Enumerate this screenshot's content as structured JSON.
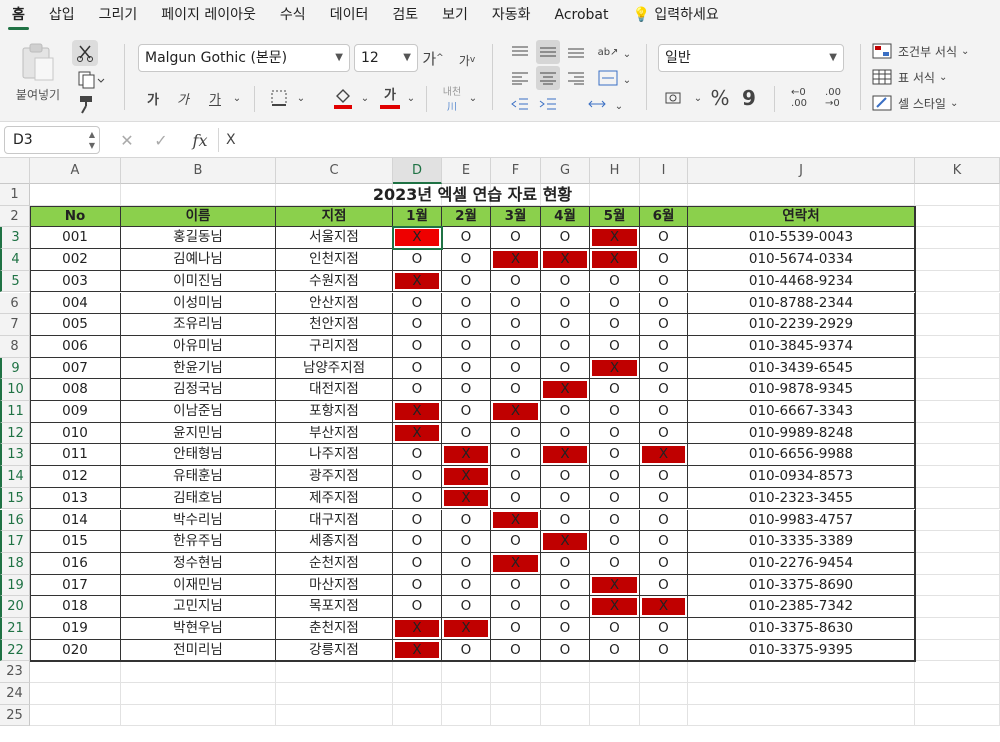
{
  "ribbon_tabs": [
    "홈",
    "삽입",
    "그리기",
    "페이지 레이아웃",
    "수식",
    "데이터",
    "검토",
    "보기",
    "자동화",
    "Acrobat",
    "입력하세요"
  ],
  "ribbon": {
    "paste_label": "붙여넣기",
    "font_name": "Malgun Gothic (본문)",
    "font_size": "12",
    "grow_font": "가",
    "shrink_font": "가",
    "bold": "가",
    "italic": "가",
    "underline": "가",
    "font_color_glyph": "가",
    "phonetic_label": "내천",
    "number_format": "일반",
    "conditional_format": "조건부 서식",
    "format_as_table": "표 서식",
    "cell_styles": "셀 스타일",
    "percent": "%",
    "comma": "9",
    "inc_decimal": "←0\n.00",
    "dec_decimal": ".00\n→0"
  },
  "formula_bar": {
    "name_box": "D3",
    "fx": "fx",
    "content": "X"
  },
  "columns": [
    "A",
    "B",
    "C",
    "D",
    "E",
    "F",
    "G",
    "H",
    "I",
    "J",
    "K"
  ],
  "rows": [
    "1",
    "2",
    "3",
    "4",
    "5",
    "6",
    "7",
    "8",
    "9",
    "10",
    "11",
    "12",
    "13",
    "14",
    "15",
    "16",
    "17",
    "18",
    "19",
    "20",
    "21",
    "22",
    "23",
    "24",
    "25"
  ],
  "sheet": {
    "title": "2023년 엑셀 연습 자료 현황",
    "headers": [
      "No",
      "이름",
      "지점",
      "1월",
      "2월",
      "3월",
      "4월",
      "5월",
      "6월",
      "연락처"
    ],
    "records": [
      [
        "001",
        "홍길동님",
        "서울지점",
        "X",
        "O",
        "O",
        "O",
        "X",
        "O",
        "010-5539-0043"
      ],
      [
        "002",
        "김예나님",
        "인천지점",
        "O",
        "O",
        "X",
        "X",
        "X",
        "O",
        "010-5674-0334"
      ],
      [
        "003",
        "이미진님",
        "수원지점",
        "X",
        "O",
        "O",
        "O",
        "O",
        "O",
        "010-4468-9234"
      ],
      [
        "004",
        "이성미님",
        "안산지점",
        "O",
        "O",
        "O",
        "O",
        "O",
        "O",
        "010-8788-2344"
      ],
      [
        "005",
        "조유리님",
        "천안지점",
        "O",
        "O",
        "O",
        "O",
        "O",
        "O",
        "010-2239-2929"
      ],
      [
        "006",
        "아유미님",
        "구리지점",
        "O",
        "O",
        "O",
        "O",
        "O",
        "O",
        "010-3845-9374"
      ],
      [
        "007",
        "한윤기님",
        "남양주지점",
        "O",
        "O",
        "O",
        "O",
        "X",
        "O",
        "010-3439-6545"
      ],
      [
        "008",
        "김정국님",
        "대전지점",
        "O",
        "O",
        "O",
        "X",
        "O",
        "O",
        "010-9878-9345"
      ],
      [
        "009",
        "이남준님",
        "포항지점",
        "X",
        "O",
        "X",
        "O",
        "O",
        "O",
        "010-6667-3343"
      ],
      [
        "010",
        "윤지민님",
        "부산지점",
        "X",
        "O",
        "O",
        "O",
        "O",
        "O",
        "010-9989-8248"
      ],
      [
        "011",
        "안태형님",
        "나주지점",
        "O",
        "X",
        "O",
        "X",
        "O",
        "X",
        "010-6656-9988"
      ],
      [
        "012",
        "유태훈님",
        "광주지점",
        "O",
        "X",
        "O",
        "O",
        "O",
        "O",
        "010-0934-8573"
      ],
      [
        "013",
        "김태호님",
        "제주지점",
        "O",
        "X",
        "O",
        "O",
        "O",
        "O",
        "010-2323-3455"
      ],
      [
        "014",
        "박수리님",
        "대구지점",
        "O",
        "O",
        "X",
        "O",
        "O",
        "O",
        "010-9983-4757"
      ],
      [
        "015",
        "한유주님",
        "세종지점",
        "O",
        "O",
        "O",
        "X",
        "O",
        "O",
        "010-3335-3389"
      ],
      [
        "016",
        "정수현님",
        "순천지점",
        "O",
        "O",
        "X",
        "O",
        "O",
        "O",
        "010-2276-9454"
      ],
      [
        "017",
        "이재민님",
        "마산지점",
        "O",
        "O",
        "O",
        "O",
        "X",
        "O",
        "010-3375-8690"
      ],
      [
        "018",
        "고민지님",
        "목포지점",
        "O",
        "O",
        "O",
        "O",
        "X",
        "X",
        "010-2385-7342"
      ],
      [
        "019",
        "박현우님",
        "춘천지점",
        "X",
        "X",
        "O",
        "O",
        "O",
        "O",
        "010-3375-8630"
      ],
      [
        "020",
        "전미리님",
        "강릉지점",
        "X",
        "O",
        "O",
        "O",
        "O",
        "O",
        "010-3375-9395"
      ]
    ]
  },
  "colors": {
    "accent": "#1f7244",
    "header_fill": "#8bd04c",
    "x_fill": "#c00000",
    "x_fill_selected": "#ee0000"
  }
}
